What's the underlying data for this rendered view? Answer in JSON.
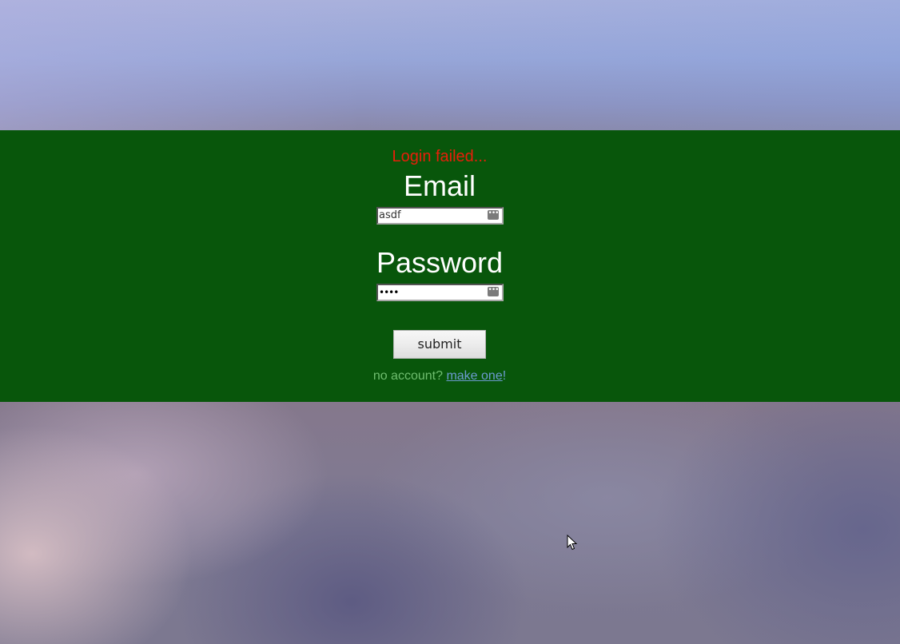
{
  "status": {
    "error_message": "Login failed..."
  },
  "form": {
    "email_label": "Email",
    "email_value": "asdf",
    "password_label": "Password",
    "password_mask": "••••",
    "submit_label": "submit"
  },
  "signup": {
    "prompt": "no account?",
    "link_label": "make one",
    "suffix": "!"
  },
  "colors": {
    "panel_background": "#08560b",
    "error_text": "#e81e0a",
    "link_text": "#6d9bd1"
  },
  "icons": {
    "password_manager": "password-manager-key-icon",
    "cursor": "mouse-cursor-icon"
  }
}
